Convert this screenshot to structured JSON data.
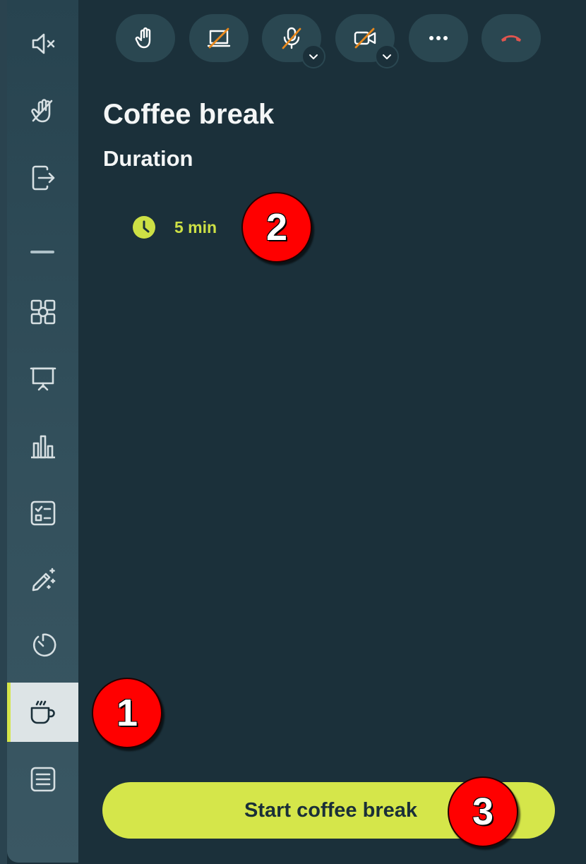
{
  "toolbar": {
    "buttons": [
      {
        "name": "raise-hand",
        "icon": "hand-icon"
      },
      {
        "name": "screen-share",
        "icon": "screen-share-off-icon"
      },
      {
        "name": "microphone",
        "icon": "microphone-off-icon"
      },
      {
        "name": "camera",
        "icon": "camera-off-icon"
      },
      {
        "name": "more",
        "icon": "more-horizontal-icon"
      },
      {
        "name": "hang-up",
        "icon": "phone-hangup-icon"
      }
    ],
    "colors": {
      "strike": "#e8891d",
      "hangup": "#e0554f",
      "button_bg": "#2a4751"
    }
  },
  "sidebar": {
    "items": [
      {
        "icon": "speaker-muted-icon"
      },
      {
        "icon": "hand-off-icon"
      },
      {
        "icon": "leave-icon"
      },
      {
        "icon": "layout-grid-icon"
      },
      {
        "icon": "presentation-icon"
      },
      {
        "icon": "bar-chart-icon"
      },
      {
        "icon": "checklist-icon"
      },
      {
        "icon": "magic-wand-icon"
      },
      {
        "icon": "timer-icon"
      },
      {
        "icon": "coffee-icon",
        "active": true
      },
      {
        "icon": "notes-icon"
      }
    ]
  },
  "panel": {
    "title": "Coffee break",
    "subtitle": "Duration",
    "duration": {
      "icon": "clock-icon",
      "value": "5 min"
    },
    "start_label": "Start coffee break"
  },
  "markers": [
    "1",
    "2",
    "3"
  ],
  "colors": {
    "accent": "#d5e64a",
    "background": "#1b303a",
    "text": "#f4f6f6"
  }
}
